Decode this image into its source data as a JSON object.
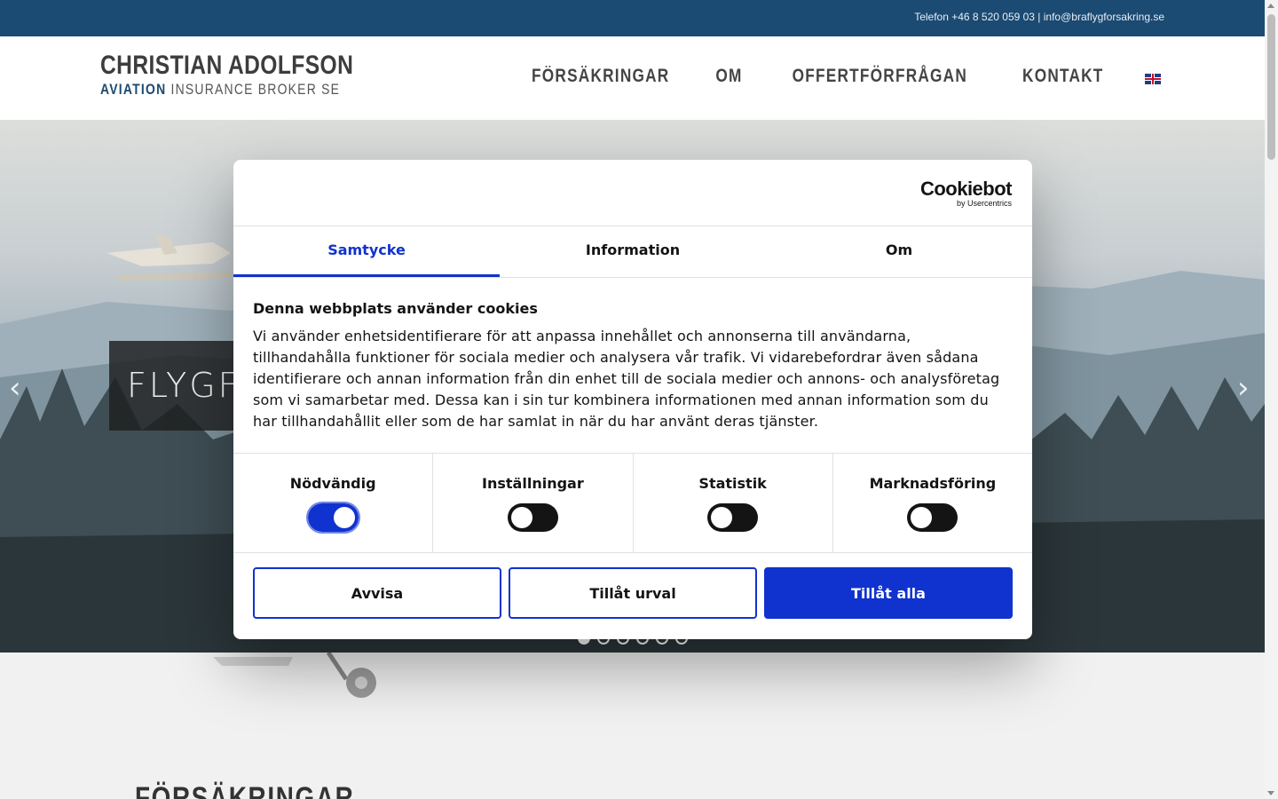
{
  "topbar": {
    "contact": "Telefon +46 8 520 059 03 | info@braflygforsakring.se"
  },
  "logo": {
    "line1": "CHRISTIAN ADOLFSON",
    "line2_bold": "AVIATION",
    "line2_rest": " INSURANCE BROKER SE"
  },
  "nav": {
    "items": [
      "FÖRSÄKRINGAR",
      "OM",
      "OFFERTFÖRFRÅGAN",
      "KONTAKT"
    ],
    "language_icon": "uk-flag-icon"
  },
  "hero": {
    "caption": "FLYGFÖRSÄKRING",
    "prev_icon": "chevron-left-icon",
    "next_icon": "chevron-right-icon",
    "slide_count": 6,
    "active_slide": 1
  },
  "section": {
    "heading": "FÖRSÄKRINGAR"
  },
  "cookie": {
    "brand": "Cookiebot",
    "brand_sub": "by Usercentrics",
    "tabs": [
      "Samtycke",
      "Information",
      "Om"
    ],
    "active_tab": "Samtycke",
    "title": "Denna webbplats använder cookies",
    "text": "Vi använder enhetsidentifierare för att anpassa innehållet och annonserna till användarna, tillhandahålla funktioner för sociala medier och analysera vår trafik. Vi vidarebefordrar även sådana identifierare och annan information från din enhet till de sociala medier och annons- och analysföretag som vi samarbetar med. Dessa kan i sin tur kombinera informationen med annan information som du har tillhandahållit eller som de har samlat in när du har använt deras tjänster.",
    "toggles": [
      {
        "label": "Nödvändig",
        "on": true
      },
      {
        "label": "Inställningar",
        "on": false
      },
      {
        "label": "Statistik",
        "on": false
      },
      {
        "label": "Marknadsföring",
        "on": false
      }
    ],
    "buttons": {
      "reject": "Avvisa",
      "selection": "Tillåt urval",
      "accept_all": "Tillåt alla"
    },
    "accent_color": "#1032cf"
  }
}
